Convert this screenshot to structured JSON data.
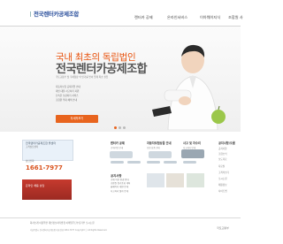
{
  "header": {
    "logo": "전국렌터카공제조합",
    "nav": [
      "렌터카 공제",
      "온라인서비스",
      "이아웨이지식",
      "조합원 사"
    ]
  },
  "hero": {
    "subtitle": "국내 최초의 독립법인",
    "title": "전국렌터카공제조합",
    "desc": "국토교통부 및 국세청장 의 인가를 받아 업계 최초 설립",
    "bullets": [
      "자동차보험 공제가입 안내",
      "대인·대물 사고처리 지원",
      "신속한 보상처리 서비스",
      "조합원 우대 혜택 안내"
    ],
    "button": "자세히보기",
    "dots": 3,
    "active_dot": 0
  },
  "left": {
    "banner1_title": "전국렌터카공제조합 콜센터",
    "banner1_sub": "고객상담센터",
    "phone_label": "상담전화",
    "phone": "1661-7977",
    "banner2_text": "온라인 채용 상담"
  },
  "services": [
    {
      "title": "렌터카 공제",
      "desc": "공제가입 안내"
    },
    {
      "title": "자동차보험상품 안내",
      "desc": "보험 상품 안내"
    },
    {
      "title": "사고 및 차수리",
      "desc": "사고처리 안내"
    }
  ],
  "notice": {
    "title": "공지사항",
    "items": [
      "공제 약관 변경 안내",
      "조합원 정기총회 개최",
      "홈페이지 개편 안내",
      "사고처리 절차 안내"
    ]
  },
  "right": {
    "title": "공지사항/오름",
    "items": [
      "공지사항",
      "조합소식",
      "보도자료",
      "자료실",
      "고객의소리",
      "오시는길",
      "채용정보",
      "사이트맵"
    ]
  },
  "footer": {
    "links": "회사소개   이용약관   개인정보처리방침   이메일무단수집거부   오시는길",
    "info": "서울특별시 전국렌터카공제조합   대표전화 1661-7977   Copyright ⓒ All Rights Reserved.",
    "logo": "국토교통부"
  },
  "colors": {
    "accent": "#e8641e",
    "brand": "#2a4f9c"
  }
}
